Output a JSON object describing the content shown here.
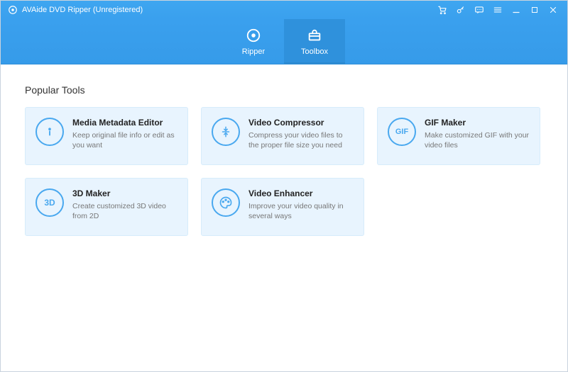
{
  "titlebar": {
    "app_title": "AVAide DVD Ripper (Unregistered)"
  },
  "tabs": {
    "ripper_label": "Ripper",
    "toolbox_label": "Toolbox",
    "active": "toolbox"
  },
  "section": {
    "title": "Popular Tools"
  },
  "tools": [
    {
      "id": "media-metadata-editor",
      "icon": "info-icon",
      "icon_text": "i",
      "title": "Media Metadata Editor",
      "desc": "Keep original file info or edit as you want"
    },
    {
      "id": "video-compressor",
      "icon": "compress-icon",
      "icon_text": "↕",
      "title": "Video Compressor",
      "desc": "Compress your video files to the proper file size you need"
    },
    {
      "id": "gif-maker",
      "icon": "gif-icon",
      "icon_text": "GIF",
      "title": "GIF Maker",
      "desc": "Make customized GIF with your video files"
    },
    {
      "id": "3d-maker",
      "icon": "3d-icon",
      "icon_text": "3D",
      "title": "3D Maker",
      "desc": "Create customized 3D video from 2D"
    },
    {
      "id": "video-enhancer",
      "icon": "palette-icon",
      "icon_text": "🎨",
      "title": "Video Enhancer",
      "desc": "Improve your video quality in several ways"
    }
  ],
  "colors": {
    "accent": "#3aa0ee",
    "card_bg": "#e8f4fe",
    "icon_ring": "#49a8ef"
  }
}
